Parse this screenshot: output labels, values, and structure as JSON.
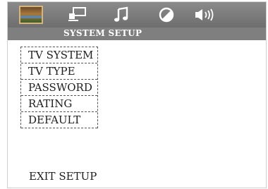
{
  "tabs": [
    {
      "icon": "picture-icon"
    },
    {
      "icon": "video-setup-icon"
    },
    {
      "icon": "music-note-icon"
    },
    {
      "icon": "contrast-icon"
    },
    {
      "icon": "speaker-icon"
    }
  ],
  "section_title": "SYSTEM SETUP",
  "menu": {
    "items": [
      {
        "label": "TV SYSTEM"
      },
      {
        "label": "TV TYPE"
      },
      {
        "label": "PASSWORD"
      },
      {
        "label": "RATING"
      },
      {
        "label": "DEFAULT"
      }
    ]
  },
  "exit_label": "EXIT SETUP",
  "colors": {
    "topbar": "#7a7a7a",
    "subbar": "#7f7f7f",
    "text": "#1e1e1e"
  }
}
